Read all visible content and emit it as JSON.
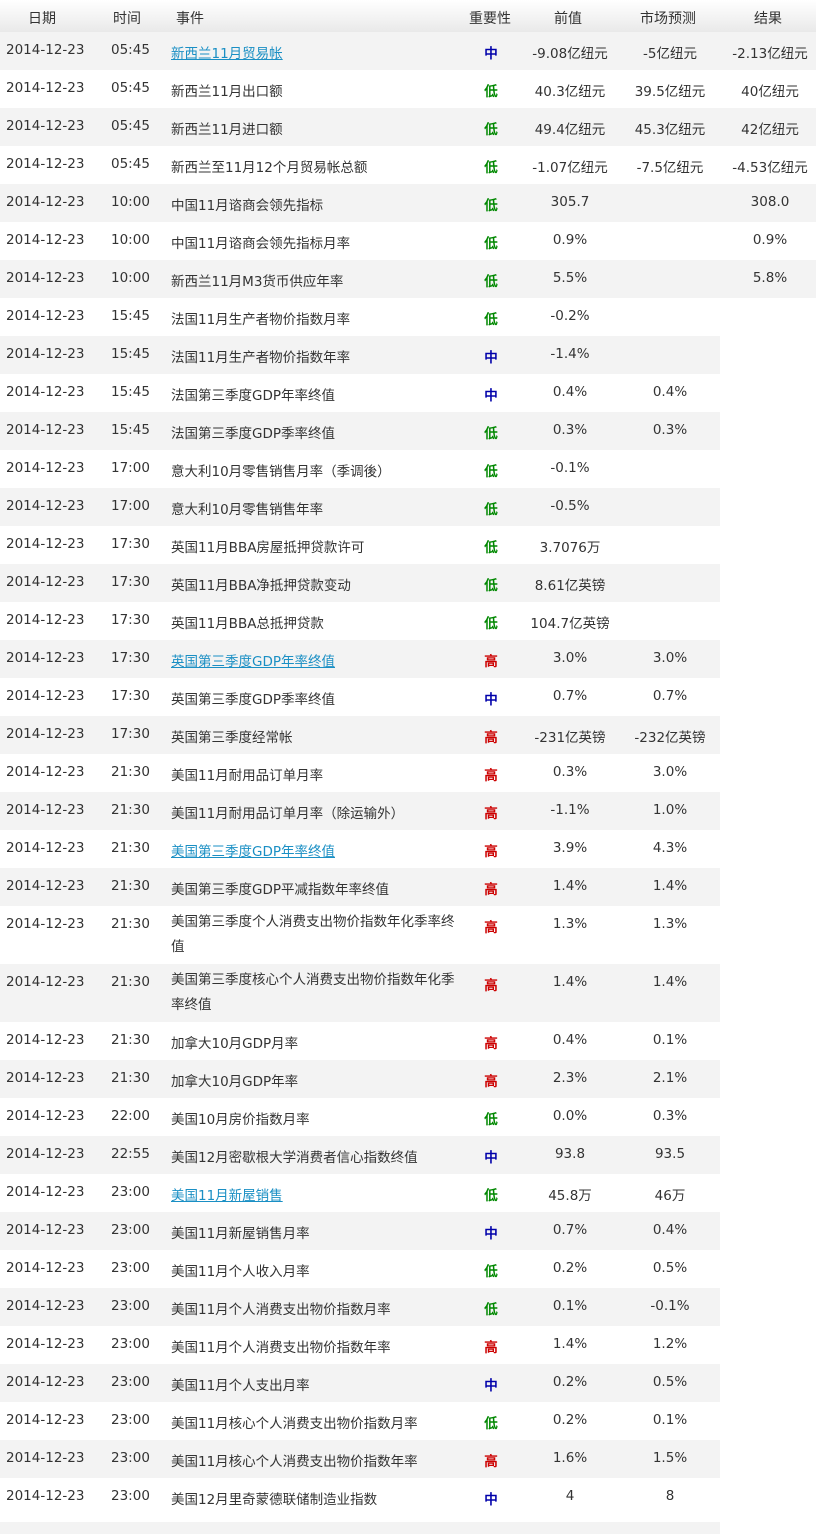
{
  "columns": {
    "date": "日期",
    "time": "时间",
    "event": "事件",
    "importance": "重要性",
    "previous": "前值",
    "forecast": "市场预测",
    "actual": "结果"
  },
  "rows": [
    {
      "date": "2014-12-23",
      "time": "05:45",
      "event": "新西兰11月贸易帐",
      "importance": "中",
      "previous": "-9.08亿纽元",
      "forecast": "-5亿纽元",
      "actual": "-2.13亿纽元",
      "link": true
    },
    {
      "date": "2014-12-23",
      "time": "05:45",
      "event": "新西兰11月出口额",
      "importance": "低",
      "previous": "40.3亿纽元",
      "forecast": "39.5亿纽元",
      "actual": "40亿纽元"
    },
    {
      "date": "2014-12-23",
      "time": "05:45",
      "event": "新西兰11月进口额",
      "importance": "低",
      "previous": "49.4亿纽元",
      "forecast": "45.3亿纽元",
      "actual": "42亿纽元"
    },
    {
      "date": "2014-12-23",
      "time": "05:45",
      "event": "新西兰至11月12个月贸易帐总额",
      "importance": "低",
      "previous": "-1.07亿纽元",
      "forecast": "-7.5亿纽元",
      "actual": "-4.53亿纽元"
    },
    {
      "date": "2014-12-23",
      "time": "10:00",
      "event": "中国11月谘商会领先指标",
      "importance": "低",
      "previous": "305.7",
      "forecast": "",
      "actual": "308.0"
    },
    {
      "date": "2014-12-23",
      "time": "10:00",
      "event": "中国11月谘商会领先指标月率",
      "importance": "低",
      "previous": "0.9%",
      "forecast": "",
      "actual": "0.9%"
    },
    {
      "date": "2014-12-23",
      "time": "10:00",
      "event": "新西兰11月M3货币供应年率",
      "importance": "低",
      "previous": "5.5%",
      "forecast": "",
      "actual": "5.8%"
    },
    {
      "date": "2014-12-23",
      "time": "15:45",
      "event": "法国11月生产者物价指数月率",
      "importance": "低",
      "previous": "-0.2%",
      "forecast": "",
      "actual": ""
    },
    {
      "date": "2014-12-23",
      "time": "15:45",
      "event": "法国11月生产者物价指数年率",
      "importance": "中",
      "previous": "-1.4%",
      "forecast": "",
      "actual": ""
    },
    {
      "date": "2014-12-23",
      "time": "15:45",
      "event": "法国第三季度GDP年率终值",
      "importance": "中",
      "previous": "0.4%",
      "forecast": "0.4%",
      "actual": ""
    },
    {
      "date": "2014-12-23",
      "time": "15:45",
      "event": "法国第三季度GDP季率终值",
      "importance": "低",
      "previous": "0.3%",
      "forecast": "0.3%",
      "actual": ""
    },
    {
      "date": "2014-12-23",
      "time": "17:00",
      "event": "意大利10月零售销售月率（季调後）",
      "importance": "低",
      "previous": "-0.1%",
      "forecast": "",
      "actual": ""
    },
    {
      "date": "2014-12-23",
      "time": "17:00",
      "event": "意大利10月零售销售年率",
      "importance": "低",
      "previous": "-0.5%",
      "forecast": "",
      "actual": ""
    },
    {
      "date": "2014-12-23",
      "time": "17:30",
      "event": "英国11月BBA房屋抵押贷款许可",
      "importance": "低",
      "previous": "3.7076万",
      "forecast": "",
      "actual": ""
    },
    {
      "date": "2014-12-23",
      "time": "17:30",
      "event": "英国11月BBA净抵押贷款变动",
      "importance": "低",
      "previous": "8.61亿英镑",
      "forecast": "",
      "actual": ""
    },
    {
      "date": "2014-12-23",
      "time": "17:30",
      "event": "英国11月BBA总抵押贷款",
      "importance": "低",
      "previous": "104.7亿英镑",
      "forecast": "",
      "actual": ""
    },
    {
      "date": "2014-12-23",
      "time": "17:30",
      "event": "英国第三季度GDP年率终值",
      "importance": "高",
      "previous": "3.0%",
      "forecast": "3.0%",
      "actual": "",
      "link": true
    },
    {
      "date": "2014-12-23",
      "time": "17:30",
      "event": "英国第三季度GDP季率终值",
      "importance": "中",
      "previous": "0.7%",
      "forecast": "0.7%",
      "actual": ""
    },
    {
      "date": "2014-12-23",
      "time": "17:30",
      "event": "英国第三季度经常帐",
      "importance": "高",
      "previous": "-231亿英镑",
      "forecast": "-232亿英镑",
      "actual": ""
    },
    {
      "date": "2014-12-23",
      "time": "21:30",
      "event": "美国11月耐用品订单月率",
      "importance": "高",
      "previous": "0.3%",
      "forecast": "3.0%",
      "actual": ""
    },
    {
      "date": "2014-12-23",
      "time": "21:30",
      "event": "美国11月耐用品订单月率（除运输外）",
      "importance": "高",
      "previous": "-1.1%",
      "forecast": "1.0%",
      "actual": ""
    },
    {
      "date": "2014-12-23",
      "time": "21:30",
      "event": "美国第三季度GDP年率终值",
      "importance": "高",
      "previous": "3.9%",
      "forecast": "4.3%",
      "actual": "",
      "link": true
    },
    {
      "date": "2014-12-23",
      "time": "21:30",
      "event": "美国第三季度GDP平减指数年率终值",
      "importance": "高",
      "previous": "1.4%",
      "forecast": "1.4%",
      "actual": ""
    },
    {
      "date": "2014-12-23",
      "time": "21:30",
      "event": "美国第三季度个人消费支出物价指数年化季率终值",
      "importance": "高",
      "previous": "1.3%",
      "forecast": "1.3%",
      "actual": "",
      "wrap": true
    },
    {
      "date": "2014-12-23",
      "time": "21:30",
      "event": "美国第三季度核心个人消费支出物价指数年化季率终值",
      "importance": "高",
      "previous": "1.4%",
      "forecast": "1.4%",
      "actual": "",
      "wrap": true
    },
    {
      "date": "2014-12-23",
      "time": "21:30",
      "event": "加拿大10月GDP月率",
      "importance": "高",
      "previous": "0.4%",
      "forecast": "0.1%",
      "actual": ""
    },
    {
      "date": "2014-12-23",
      "time": "21:30",
      "event": "加拿大10月GDP年率",
      "importance": "高",
      "previous": "2.3%",
      "forecast": "2.1%",
      "actual": ""
    },
    {
      "date": "2014-12-23",
      "time": "22:00",
      "event": "美国10月房价指数月率",
      "importance": "低",
      "previous": "0.0%",
      "forecast": "0.3%",
      "actual": ""
    },
    {
      "date": "2014-12-23",
      "time": "22:55",
      "event": "美国12月密歇根大学消费者信心指数终值",
      "importance": "中",
      "previous": "93.8",
      "forecast": "93.5",
      "actual": ""
    },
    {
      "date": "2014-12-23",
      "time": "23:00",
      "event": "美国11月新屋销售",
      "importance": "低",
      "previous": "45.8万",
      "forecast": "46万",
      "actual": "",
      "link": true
    },
    {
      "date": "2014-12-23",
      "time": "23:00",
      "event": "美国11月新屋销售月率",
      "importance": "中",
      "previous": "0.7%",
      "forecast": "0.4%",
      "actual": ""
    },
    {
      "date": "2014-12-23",
      "time": "23:00",
      "event": "美国11月个人收入月率",
      "importance": "低",
      "previous": "0.2%",
      "forecast": "0.5%",
      "actual": ""
    },
    {
      "date": "2014-12-23",
      "time": "23:00",
      "event": "美国11月个人消费支出物价指数月率",
      "importance": "低",
      "previous": "0.1%",
      "forecast": "-0.1%",
      "actual": ""
    },
    {
      "date": "2014-12-23",
      "time": "23:00",
      "event": "美国11月个人消费支出物价指数年率",
      "importance": "高",
      "previous": "1.4%",
      "forecast": "1.2%",
      "actual": ""
    },
    {
      "date": "2014-12-23",
      "time": "23:00",
      "event": "美国11月个人支出月率",
      "importance": "中",
      "previous": "0.2%",
      "forecast": "0.5%",
      "actual": ""
    },
    {
      "date": "2014-12-23",
      "time": "23:00",
      "event": "美国11月核心个人消费支出物价指数月率",
      "importance": "低",
      "previous": "0.2%",
      "forecast": "0.1%",
      "actual": ""
    },
    {
      "date": "2014-12-23",
      "time": "23:00",
      "event": "美国11月核心个人消费支出物价指数年率",
      "importance": "高",
      "previous": "1.6%",
      "forecast": "1.5%",
      "actual": ""
    },
    {
      "date": "2014-12-23",
      "time": "23:00",
      "event": "美国12月里奇蒙德联储制造业指数",
      "importance": "中",
      "previous": "4",
      "forecast": "8",
      "actual": ""
    }
  ],
  "importance_colors": {
    "高": "#cc0000",
    "中": "#0000aa",
    "低": "#008800"
  }
}
